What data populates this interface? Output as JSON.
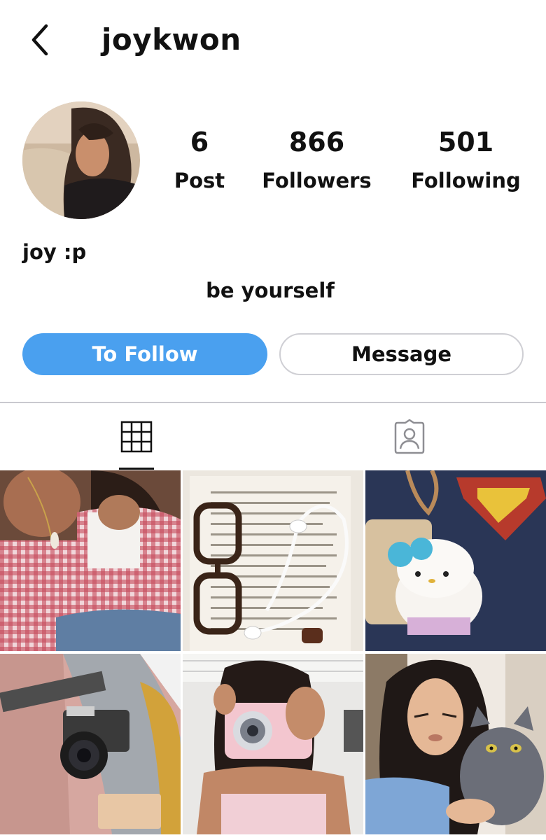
{
  "header": {
    "back_icon": "chevron-left-icon",
    "username": "joykwon"
  },
  "profile": {
    "avatar_icon": "profile-photo",
    "stats": [
      {
        "value": "6",
        "label": "Post"
      },
      {
        "value": "866",
        "label": "Followers"
      },
      {
        "value": "501",
        "label": "Following"
      }
    ],
    "display_name": "joy :p",
    "bio": "be yourself"
  },
  "actions": {
    "follow_label": "To Follow",
    "message_label": "Message"
  },
  "tabs": [
    {
      "icon": "grid-icon",
      "active": true
    },
    {
      "icon": "tagged-person-icon",
      "active": false
    }
  ],
  "colors": {
    "accent": "#4aa0ef",
    "border": "#cfcfd4"
  }
}
